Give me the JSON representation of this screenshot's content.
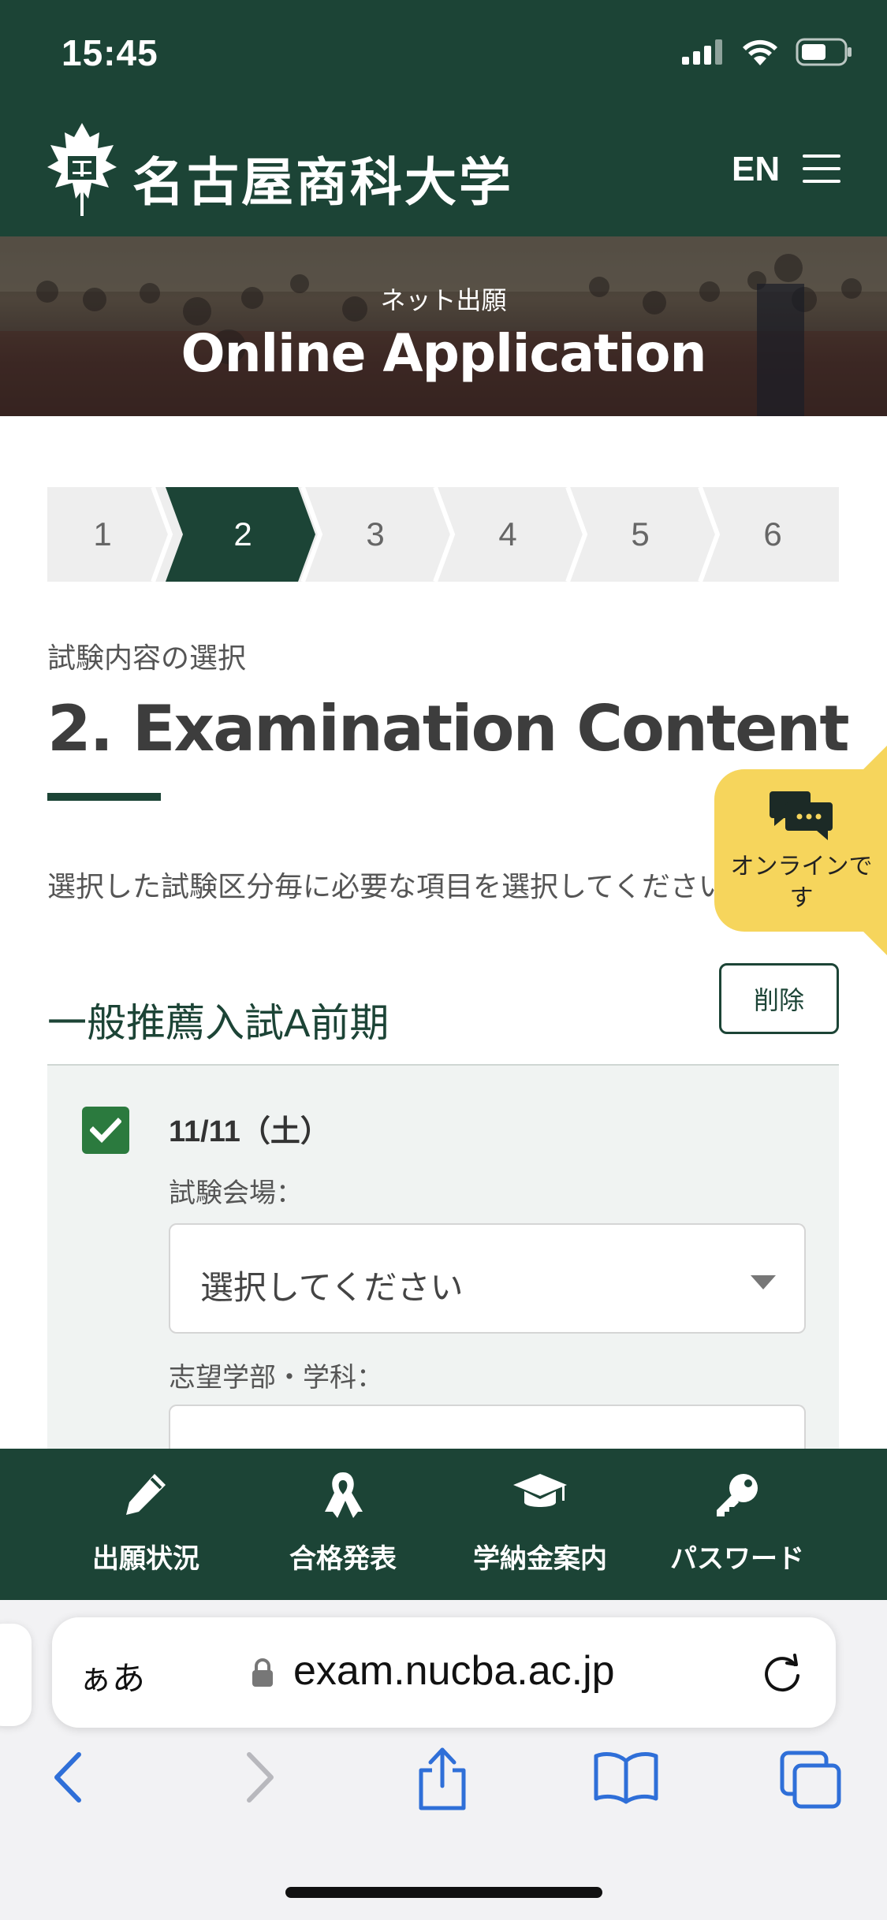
{
  "status_bar": {
    "time": "15:45"
  },
  "header": {
    "site_name": "名古屋商科大学",
    "lang_toggle": "EN"
  },
  "hero": {
    "subtitle": "ネット出願",
    "title": "Online Application"
  },
  "steps": {
    "items": [
      "1",
      "2",
      "3",
      "4",
      "5",
      "6"
    ],
    "active": "2"
  },
  "section": {
    "subtitle": "試験内容の選択",
    "title": "2. Examination Content",
    "instruction": "選択した試験区分毎に必要な項目を選択してください。"
  },
  "chat": {
    "label": "オンラインです"
  },
  "category": {
    "title": "一般推薦入試A前期",
    "delete_label": "削除",
    "exam_date": "11/11（土）",
    "venue_label": "試験会場：",
    "venue_value": "選択してください",
    "department_label": "志望学部・学科："
  },
  "bottom_nav": [
    {
      "label": "出願状況",
      "icon": "pencil-icon"
    },
    {
      "label": "合格発表",
      "icon": "ribbon-icon"
    },
    {
      "label": "学納金案内",
      "icon": "graduation-cap-icon"
    },
    {
      "label": "パスワード",
      "icon": "key-icon"
    }
  ],
  "browser": {
    "aa_label": "ぁあ",
    "url": "exam.nucba.ac.jp"
  },
  "colors": {
    "primary": "#1c4436",
    "accent": "#f6d55c",
    "checkbox": "#2b7a3e"
  }
}
